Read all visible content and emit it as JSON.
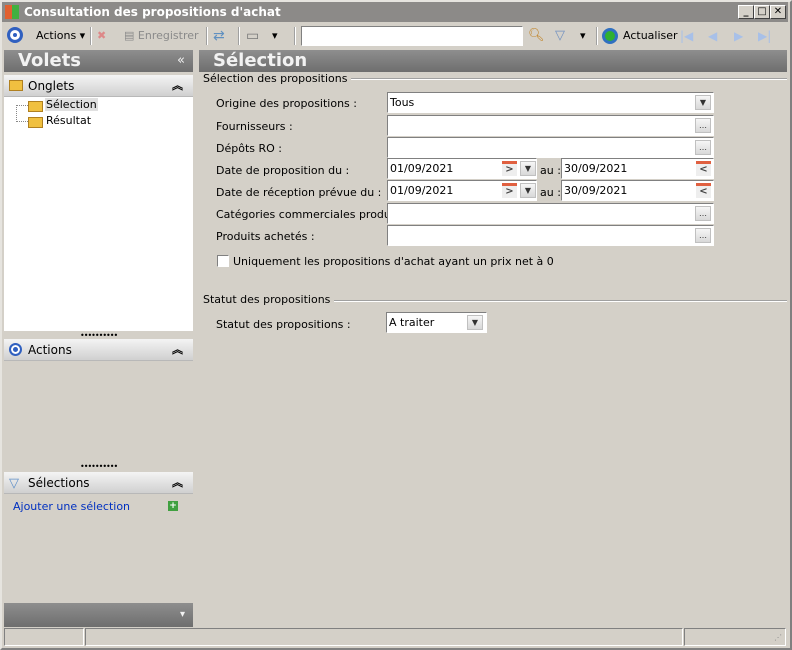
{
  "window": {
    "title": "Consultation des propositions d'achat"
  },
  "toolbar": {
    "actions": "Actions",
    "save": "Enregistrer",
    "search_value": "",
    "refresh": "Actualiser"
  },
  "left": {
    "title": "Volets",
    "onglets": "Onglets",
    "tree": [
      "Sélection",
      "Résultat"
    ],
    "actions": "Actions",
    "selections": "Sélections",
    "add_selection": "Ajouter une sélection"
  },
  "main": {
    "title": "Sélection",
    "group1": "Sélection des propositions",
    "fields": {
      "origine": {
        "label": "Origine des propositions :",
        "value": "Tous"
      },
      "fournisseurs": {
        "label": "Fournisseurs :",
        "value": ""
      },
      "depots": {
        "label": "Dépôts RO :",
        "value": ""
      },
      "date_prop": {
        "label": "Date de proposition du :",
        "from": "01/09/2021",
        "au": "au :",
        "to": "30/09/2021"
      },
      "date_recep": {
        "label": "Date de réception prévue du :",
        "from": "01/09/2021",
        "au": "au :",
        "to": "30/09/2021"
      },
      "categories": {
        "label": "Catégories commerciales produit :",
        "value": ""
      },
      "produits": {
        "label": "Produits achetés :",
        "value": ""
      }
    },
    "checkbox": {
      "label": "Uniquement les propositions d'achat ayant un prix net à 0",
      "checked": false
    },
    "group2": "Statut des propositions",
    "statut": {
      "label": "Statut des propositions :",
      "value": "A traiter"
    }
  }
}
